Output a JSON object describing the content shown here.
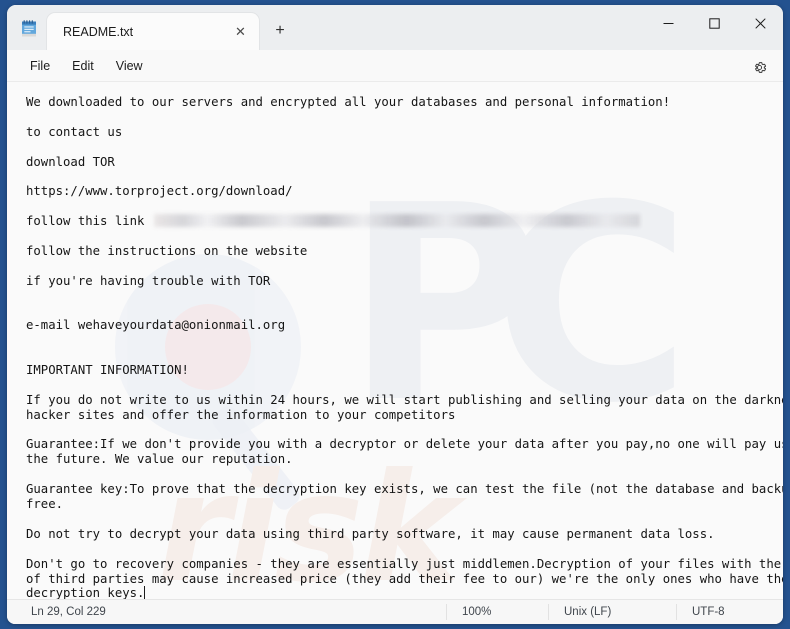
{
  "window": {
    "app": "Notepad",
    "app_icon": "notepad-icon",
    "controls": {
      "minimize": "─",
      "maximize": "□",
      "close": "✕"
    }
  },
  "tabs": [
    {
      "label": "README.txt",
      "close_icon": "✕",
      "active": true
    }
  ],
  "newtab": {
    "label": "+"
  },
  "menubar": {
    "items": [
      "File",
      "Edit",
      "View"
    ],
    "settings_icon": "gear-icon"
  },
  "document": {
    "filename": "README.txt",
    "lines": [
      {
        "text": "We downloaded to our servers and encrypted all your databases and personal information!"
      },
      {
        "text": ""
      },
      {
        "text": "to contact us"
      },
      {
        "text": ""
      },
      {
        "text": "download TOR"
      },
      {
        "text": ""
      },
      {
        "text": "https://www.torproject.org/download/"
      },
      {
        "text": ""
      },
      {
        "text": "follow this link ",
        "redacted": true
      },
      {
        "text": ""
      },
      {
        "text": "follow the instructions on the website"
      },
      {
        "text": ""
      },
      {
        "text": "if you're having trouble with TOR"
      },
      {
        "text": ""
      },
      {
        "text": ""
      },
      {
        "text": "e-mail wehaveyourdata@onionmail.org"
      },
      {
        "text": ""
      },
      {
        "text": ""
      },
      {
        "text": "IMPORTANT INFORMATION!"
      },
      {
        "text": ""
      },
      {
        "text": "If you do not write to us within 24 hours, we will start publishing and selling your data on the darknet on"
      },
      {
        "text": "hacker sites and offer the information to your competitors"
      },
      {
        "text": ""
      },
      {
        "text": "Guarantee:If we don't provide you with a decryptor or delete your data after you pay,no one will pay us in"
      },
      {
        "text": "the future. We value our reputation."
      },
      {
        "text": ""
      },
      {
        "text": "Guarantee key:To prove that the decryption key exists, we can test the file (not the database and backup) for"
      },
      {
        "text": "free."
      },
      {
        "text": ""
      },
      {
        "text": "Do not try to decrypt your data using third party software, it may cause permanent data loss."
      },
      {
        "text": ""
      },
      {
        "text": "Don't go to recovery companies - they are essentially just middlemen.Decryption of your files with the help"
      },
      {
        "text": "of third parties may cause increased price (they add their fee to our) we're the only ones who have the"
      },
      {
        "text": "decryption keys.",
        "caret": true
      }
    ]
  },
  "watermark": {
    "letter_p": "P",
    "letter_c": "C",
    "sub": "risk"
  },
  "statusbar": {
    "position": "Ln 29, Col 229",
    "zoom": "100%",
    "line_ending": "Unix (LF)",
    "encoding": "UTF-8"
  },
  "colors": {
    "desktop": "#24528f",
    "window": "#f8f8f8",
    "titlebar": "#eceef0",
    "tab_active": "#fbfbfb",
    "editor_bg": "#fafafa",
    "text": "#151515",
    "status_text": "#40464d"
  }
}
